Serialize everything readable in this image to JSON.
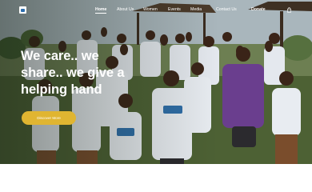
{
  "nav": {
    "items": [
      {
        "label": "Home",
        "active": true
      },
      {
        "label": "About Us",
        "active": false
      },
      {
        "label": "Women",
        "active": false
      },
      {
        "label": "Events",
        "active": false
      },
      {
        "label": "Media",
        "active": false
      },
      {
        "label": "Contact Us",
        "active": false
      },
      {
        "label": "Donate",
        "active": false
      }
    ],
    "logo_icon": "logo-mark",
    "cart_icon": "shopping-bag-icon"
  },
  "hero": {
    "headline": "We care.. we share.. we give a helping hand",
    "cta_label": "Discover More"
  },
  "colors": {
    "accent": "#e0b531",
    "text_light": "#ffffff",
    "shirt_white": "#e9edf2",
    "shirt_purple": "#6a3e8e"
  }
}
